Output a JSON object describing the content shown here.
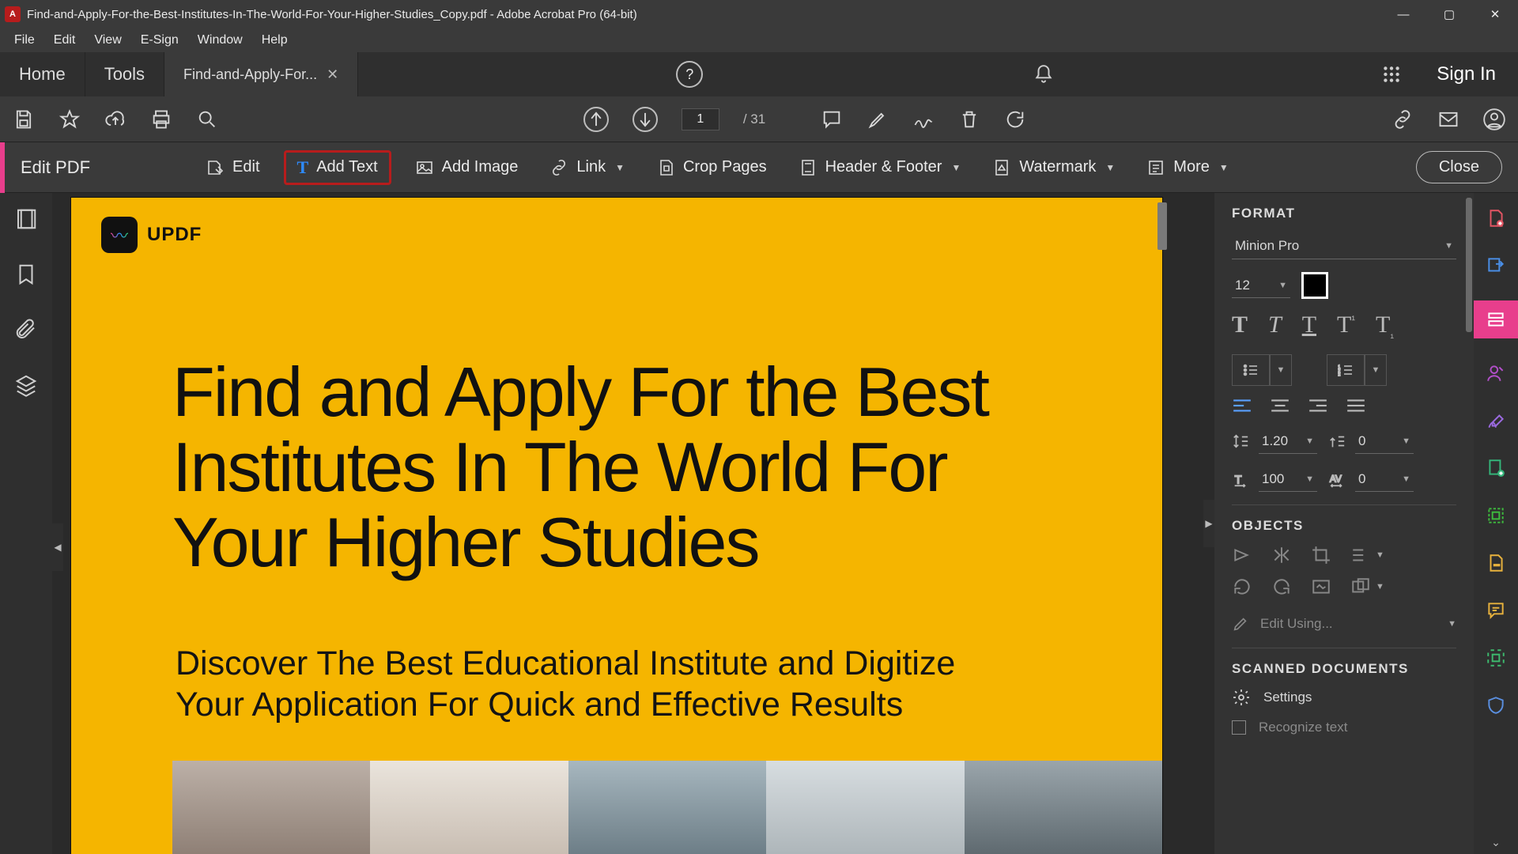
{
  "window": {
    "title": "Find-and-Apply-For-the-Best-Institutes-In-The-World-For-Your-Higher-Studies_Copy.pdf - Adobe Acrobat Pro (64-bit)"
  },
  "menu": {
    "items": [
      "File",
      "Edit",
      "View",
      "E-Sign",
      "Window",
      "Help"
    ]
  },
  "tabs": {
    "home": "Home",
    "tools": "Tools",
    "doc": "Find-and-Apply-For...",
    "signin": "Sign In"
  },
  "page_nav": {
    "current": "1",
    "total": "/ 31"
  },
  "edit_toolbar": {
    "title": "Edit PDF",
    "edit": "Edit",
    "add_text": "Add Text",
    "add_image": "Add Image",
    "link": "Link",
    "crop": "Crop Pages",
    "header_footer": "Header & Footer",
    "watermark": "Watermark",
    "more": "More",
    "close": "Close"
  },
  "document": {
    "logo_text": "UPDF",
    "headline": "Find and Apply For the Best Institutes In The World For Your Higher Studies",
    "subline": "Discover The Best Educational Institute and Digitize Your Application For Quick and Effective Results"
  },
  "format_panel": {
    "title": "FORMAT",
    "font": "Minion Pro",
    "size": "12",
    "color": "#000000",
    "line_spacing": "1.20",
    "space_before": "0",
    "h_scale": "100",
    "tracking": "0",
    "objects_title": "OBJECTS",
    "edit_using": "Edit Using...",
    "scanned_title": "SCANNED DOCUMENTS",
    "settings": "Settings",
    "recognize": "Recognize text"
  }
}
